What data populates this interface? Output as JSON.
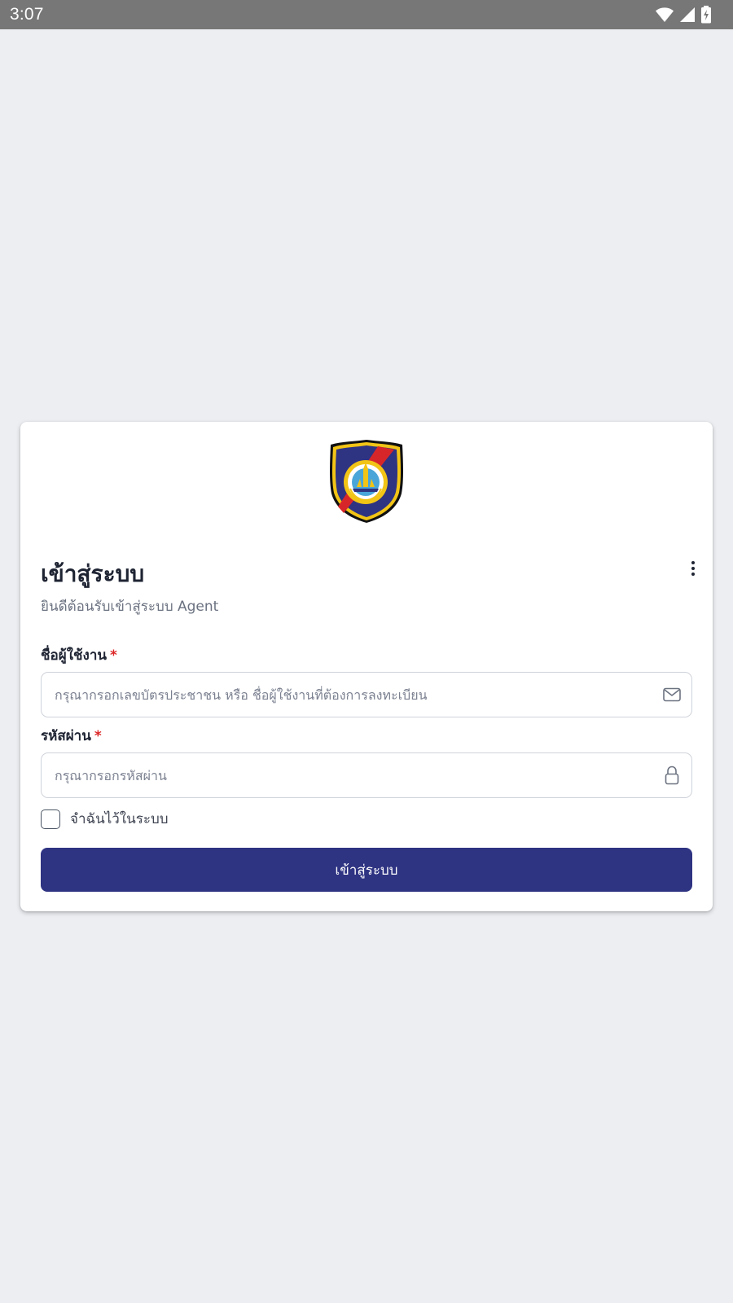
{
  "status_bar": {
    "time": "3:07",
    "icons": [
      "wifi-icon",
      "cellular-signal-icon",
      "battery-charging-icon"
    ]
  },
  "logo": {
    "icon": "tourist-police-badge",
    "text": "ตำรวจท่องเที่ยว TOURIST POLICE"
  },
  "login": {
    "title": "เข้าสู่ระบบ",
    "subtitle": "ยินดีต้อนรับเข้าสู่ระบบ Agent",
    "more_icon": "more-vertical-icon",
    "username": {
      "label": "ชื่อผู้ใช้งาน",
      "required_mark": "*",
      "value": "",
      "placeholder": "กรุณากรอกเลขบัตรประชาชน หรือ ชื่อผู้ใช้งานที่ต้องการลงทะเบียน",
      "icon": "mail-icon"
    },
    "password": {
      "label": "รหัสผ่าน",
      "required_mark": "*",
      "value": "",
      "placeholder": "กรุณากรอกรหัสผ่าน",
      "icon": "lock-icon"
    },
    "remember": {
      "label": "จำฉันไว้ในระบบ",
      "checked": false
    },
    "submit_label": "เข้าสู่ระบบ"
  },
  "colors": {
    "background": "#eceef2",
    "status_bar": "#777777",
    "primary": "#2e3382",
    "required": "#dc2626",
    "text": "#1f2433",
    "muted": "#6b7280",
    "border": "#cfd3da"
  }
}
